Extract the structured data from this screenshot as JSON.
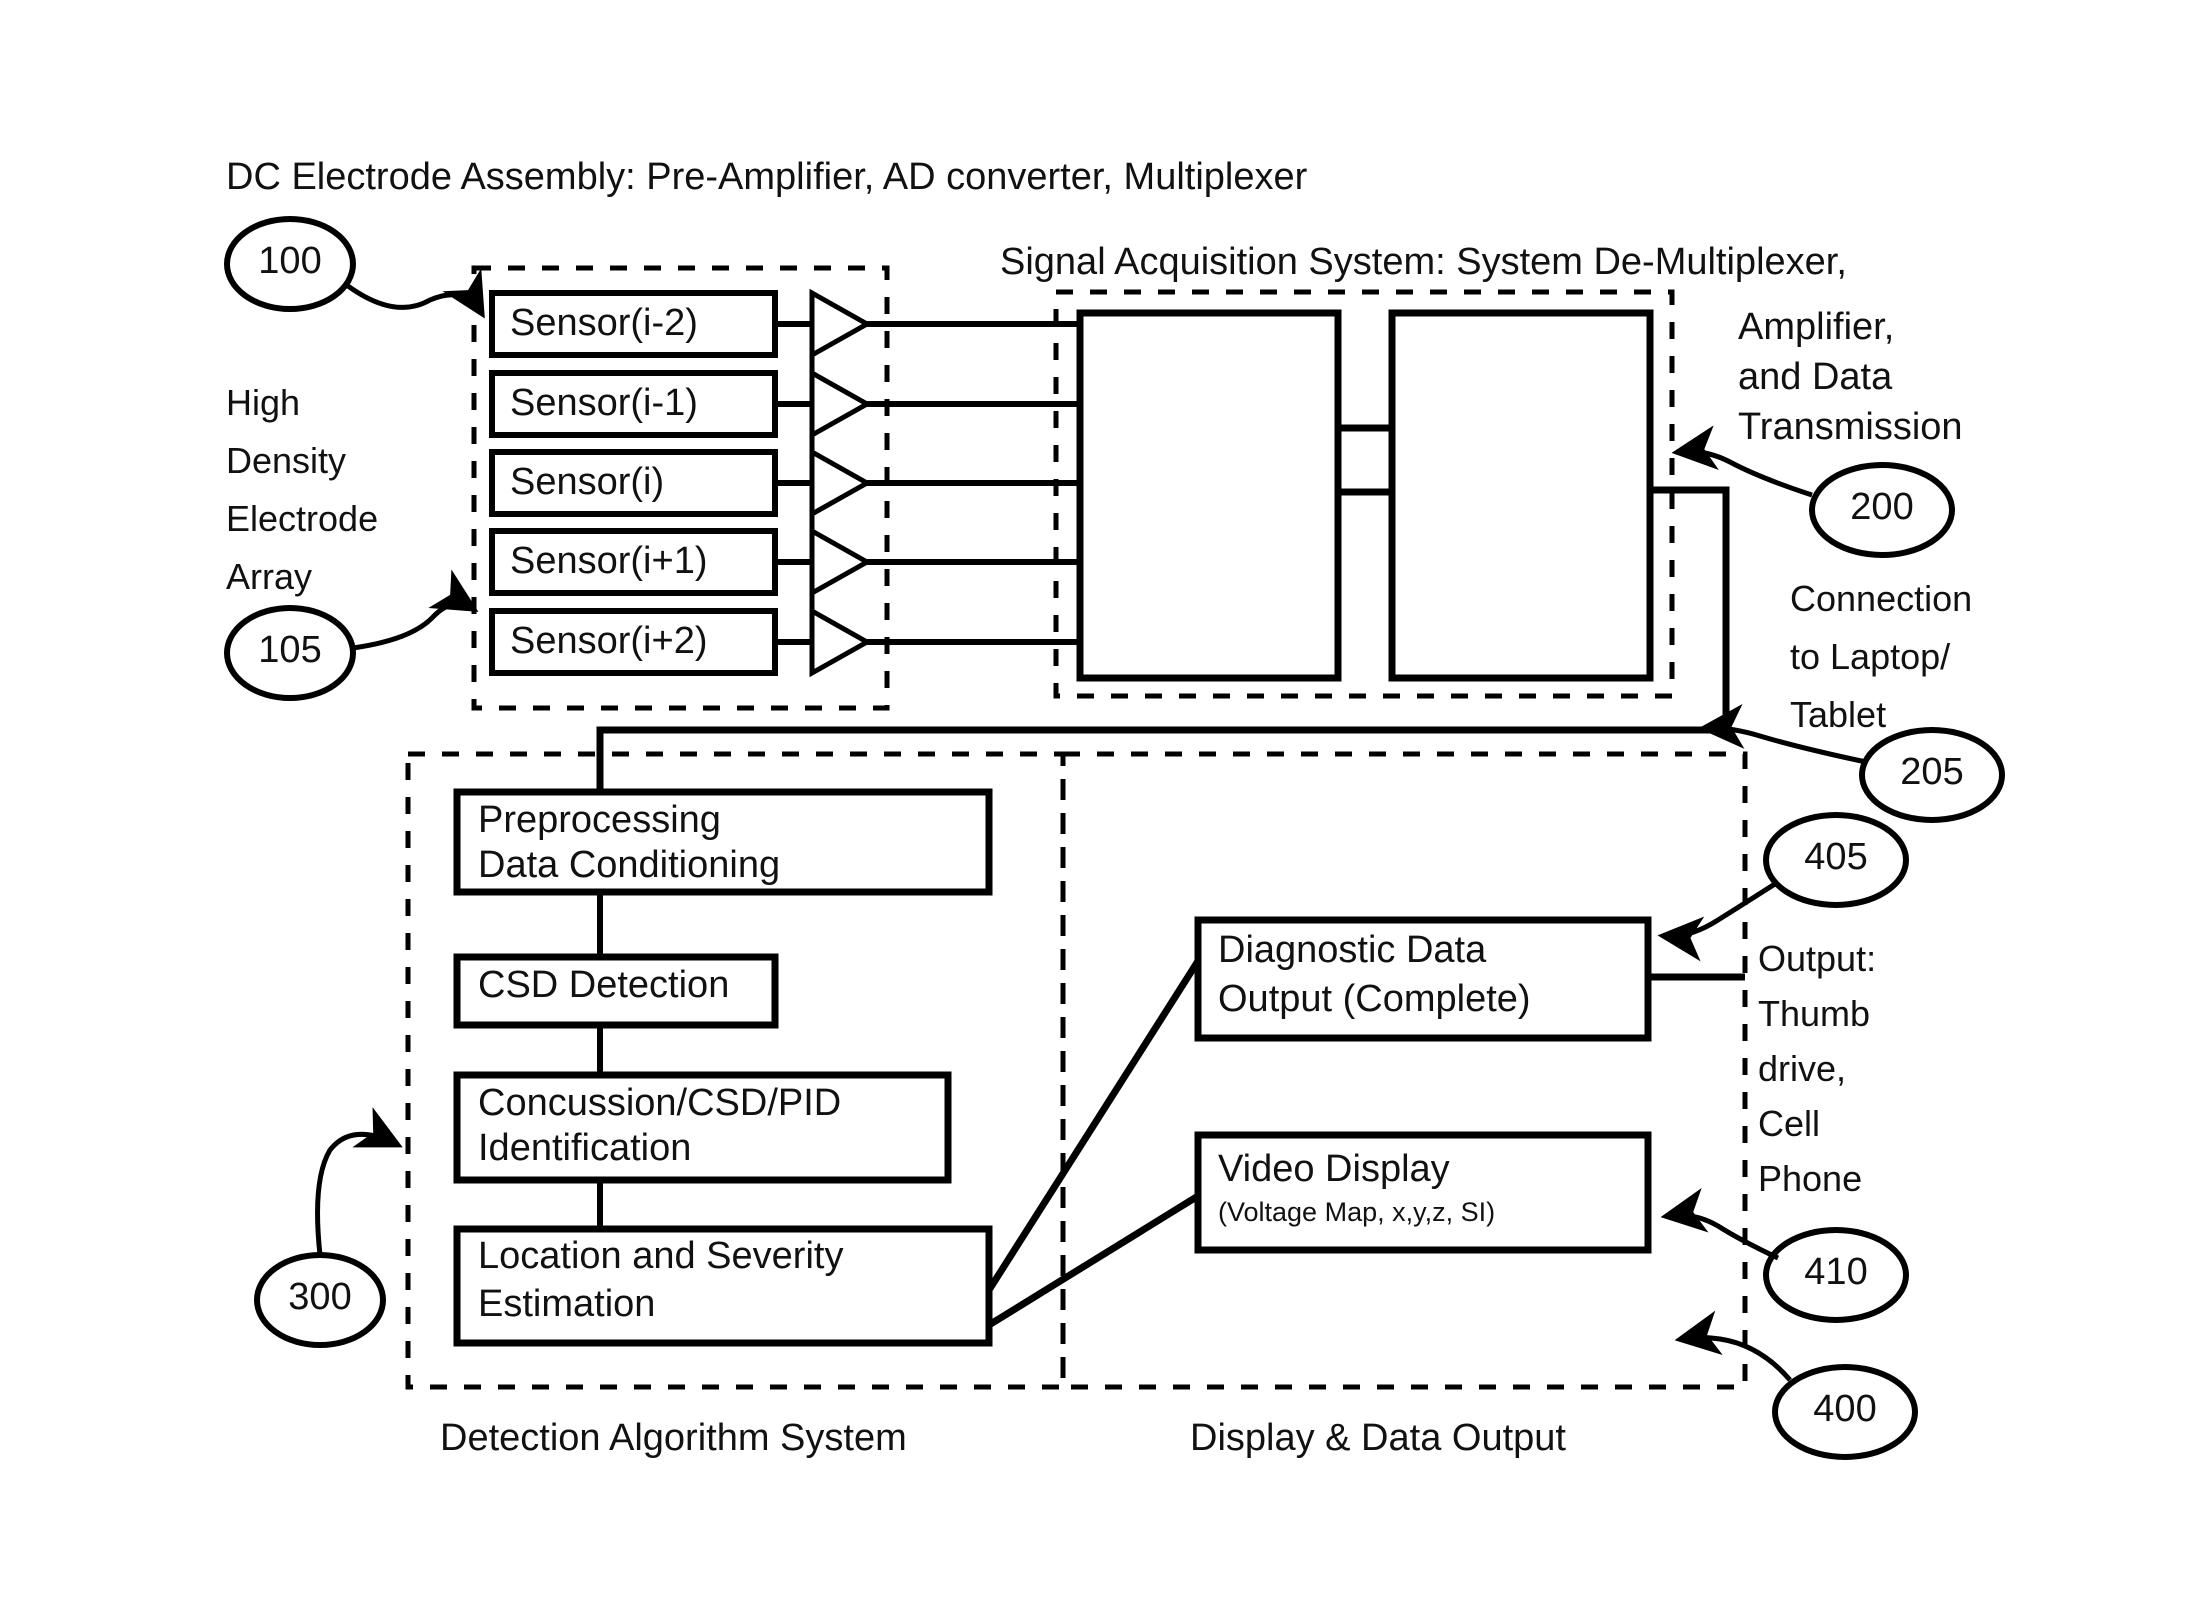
{
  "figure": {
    "titles": {
      "dc_electrode_assembly": "DC Electrode Assembly: Pre-Amplifier, AD converter, Multiplexer",
      "signal_acquisition_l1": "Signal Acquisition System: System De-Multiplexer,",
      "signal_acquisition_l2": "Amplifier,",
      "signal_acquisition_l3": "and Data",
      "signal_acquisition_l4": "Transmission"
    },
    "side_labels": {
      "electrode_array_l1": "High",
      "electrode_array_l2": "Density",
      "electrode_array_l3": "Electrode",
      "electrode_array_l4": "Array",
      "connection_l1": "Connection",
      "connection_l2": "to Laptop/",
      "connection_l3": "Tablet",
      "output_l1": "Output:",
      "output_l2": "Thumb",
      "output_l3": "drive,",
      "output_l4": "Cell",
      "output_l5": "Phone"
    },
    "captions": {
      "detection_algorithm_system": "Detection Algorithm System",
      "display_and_data_output": "Display & Data Output"
    },
    "sensors": [
      {
        "label": "Sensor(i-2)"
      },
      {
        "label": "Sensor(i-1)"
      },
      {
        "label": "Sensor(i)"
      },
      {
        "label": "Sensor(i+1)"
      },
      {
        "label": "Sensor(i+2)"
      }
    ],
    "algorithm_blocks": [
      {
        "line1": "Preprocessing",
        "line2": "Data Conditioning"
      },
      {
        "line1": "CSD Detection",
        "line2": ""
      },
      {
        "line1": "Concussion/CSD/PID",
        "line2": "Identification"
      },
      {
        "line1": "Location and Severity",
        "line2": "Estimation"
      }
    ],
    "output_blocks": [
      {
        "line1": "Diagnostic Data",
        "line2": "Output (Complete)",
        "sub": ""
      },
      {
        "line1": "Video Display",
        "line2": "",
        "sub": "(Voltage Map, x,y,z, SI)"
      }
    ],
    "reference_numerals": [
      {
        "id": "100",
        "label": "100"
      },
      {
        "id": "105",
        "label": "105"
      },
      {
        "id": "200",
        "label": "200"
      },
      {
        "id": "205",
        "label": "205"
      },
      {
        "id": "300",
        "label": "300"
      },
      {
        "id": "400",
        "label": "400"
      },
      {
        "id": "405",
        "label": "405"
      },
      {
        "id": "410",
        "label": "410"
      }
    ],
    "colors": {
      "ink": "#000000",
      "paper": "#ffffff"
    }
  }
}
